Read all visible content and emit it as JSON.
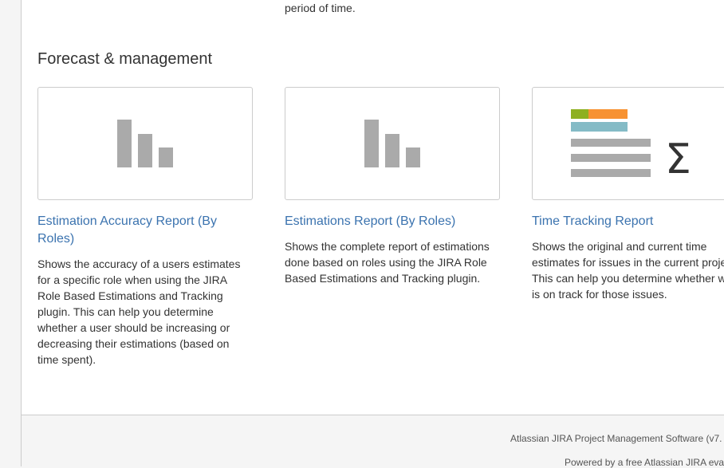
{
  "previous_section": {
    "description_tail": "period of time."
  },
  "section": {
    "title": "Forecast & management",
    "reports": [
      {
        "title": "Estimation Accuracy Report (By Roles)",
        "description": "Shows the accuracy of a users estimates for a specific role when using the JIRA Role Based Estimations and Tracking plugin. This can help you determine whether a user should be increasing or decreasing their estimations (based on time spent).",
        "icon": "bar-chart-icon"
      },
      {
        "title": "Estimations Report (By Roles)",
        "description": "Shows the complete report of estimations done based on roles using the JIRA Role Based Estimations and Tracking plugin.",
        "icon": "bar-chart-icon"
      },
      {
        "title": "Time Tracking Report",
        "description": "Shows the original and current time estimates for issues in the current project. This can help you determine whether work is on track for those issues.",
        "icon": "time-tracking-sigma-icon",
        "icon_symbol": "Σ"
      }
    ]
  },
  "footer": {
    "line1": "Atlassian JIRA Project Management Software (v7.",
    "line2": "Powered by a free Atlassian JIRA eva"
  },
  "colors": {
    "link": "#3b73af",
    "bar_gray": "#aaaaaa",
    "green": "#8eb021",
    "orange": "#f79232",
    "teal": "#84bbc6"
  }
}
